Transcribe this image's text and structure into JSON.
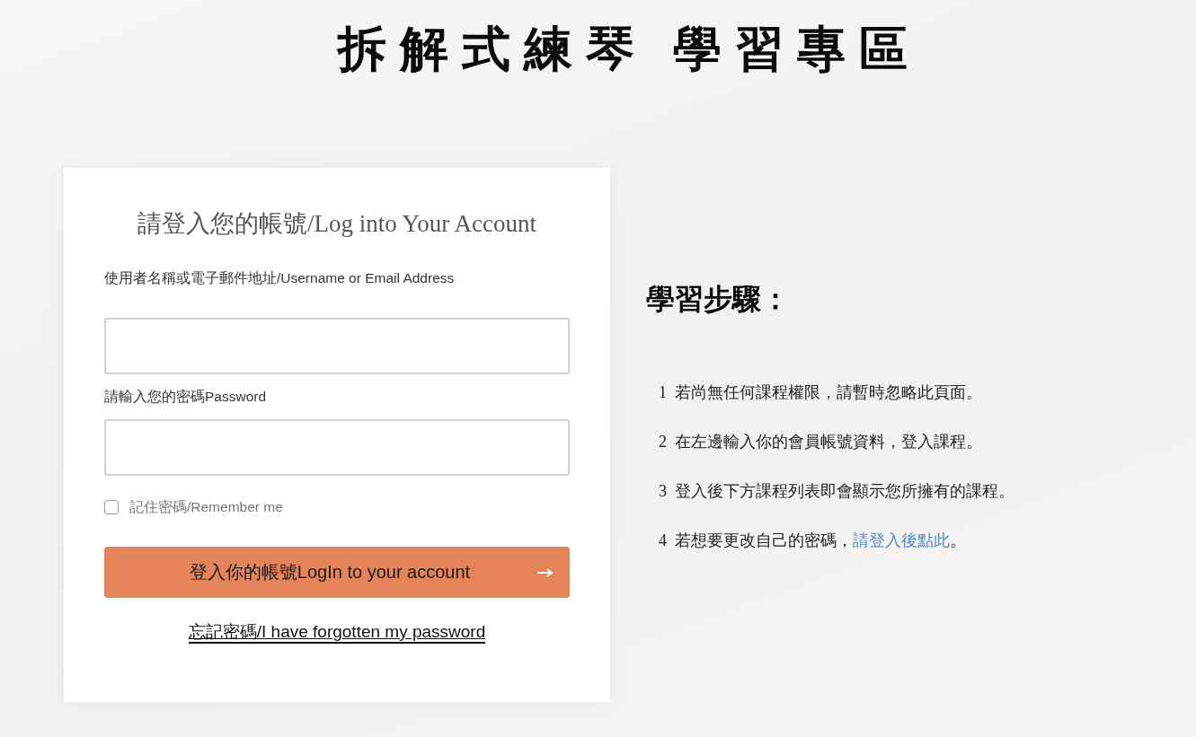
{
  "page_title": "拆解式練琴 學習專區",
  "login_card": {
    "heading": "請登入您的帳號/Log into Your Account",
    "fields": [
      {
        "label": "使用者名稱或電子郵件地址/Username or Email Address"
      },
      {
        "label": "請輸入您的密碼Password"
      }
    ],
    "remember_me": {
      "label": "記住密碼/Remember me",
      "checked": false
    },
    "submit_button": {
      "label": "登入你的帳號LogIn to your account"
    },
    "forgot_link": "忘記密碼/I have forgotten my password"
  },
  "steps": {
    "title": "學習步驟：",
    "items": [
      {
        "number": "1",
        "text": "若尚無任何課程權限，請暫時忽略此頁面。"
      },
      {
        "number": "2",
        "text": "在左邊輸入你的會員帳號資料，登入課程。"
      },
      {
        "number": "3",
        "text": "登入後下方課程列表即會顯示您所擁有的課程。"
      },
      {
        "number": "4",
        "text": "若想要更改自己的密碼，",
        "link": "請登入後點此",
        "after": "。"
      }
    ]
  }
}
